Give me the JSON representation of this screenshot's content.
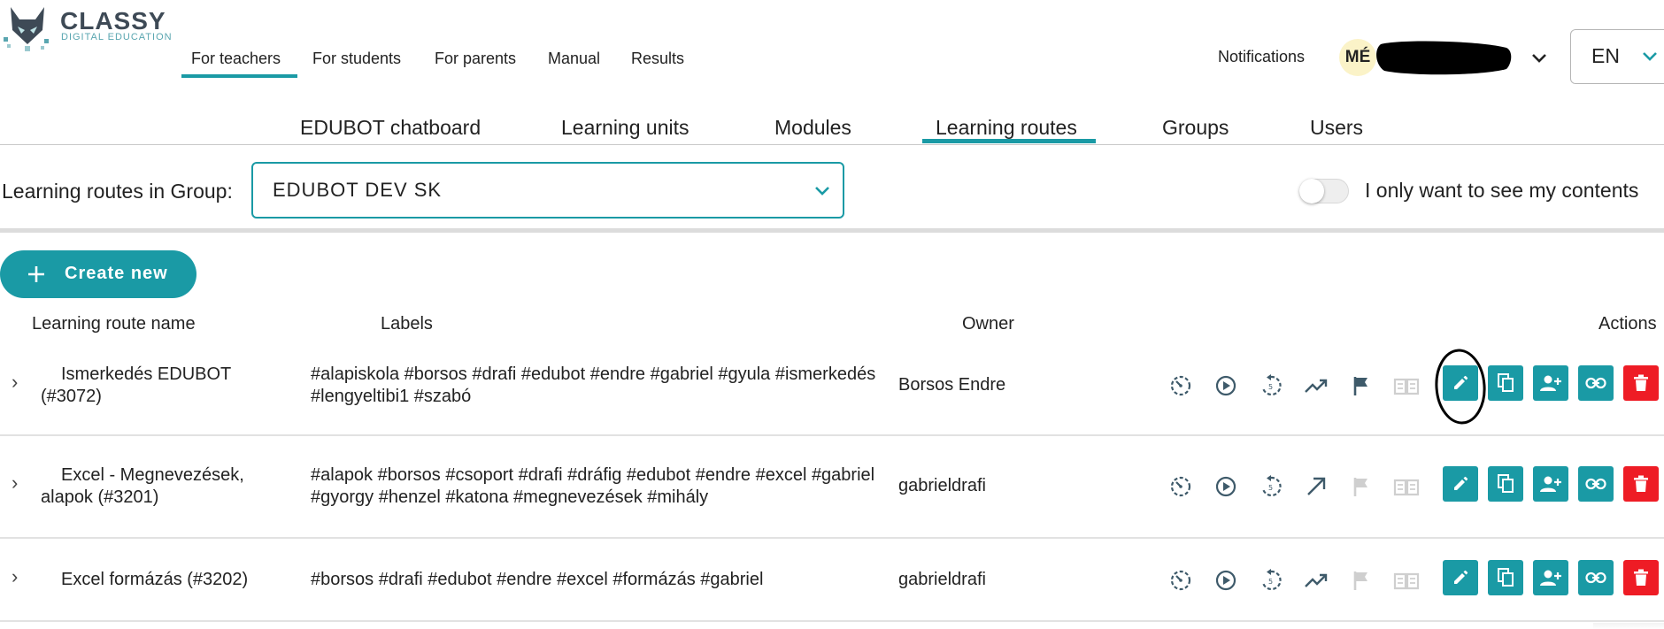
{
  "brand": {
    "title": "CLASSY",
    "subtitle": "DIGITAL EDUCATION"
  },
  "topnav": [
    "For teachers",
    "For students",
    "For parents",
    "Manual",
    "Results"
  ],
  "header": {
    "notifications": "Notifications",
    "avatar_initials": "MÉ",
    "language": "EN"
  },
  "subnav": [
    "EDUBOT chatboard",
    "Learning units",
    "Modules",
    "Learning routes",
    "Groups",
    "Users"
  ],
  "filter": {
    "group_label": "Learning routes in Group:",
    "group_value": "EDUBOT DEV SK",
    "toggle_label": "I only want to see my contents",
    "toggle_on": false
  },
  "create_label": "Create new",
  "columns": {
    "name": "Learning route name",
    "labels": "Labels",
    "owner": "Owner",
    "actions": "Actions"
  },
  "rows": [
    {
      "name": "Ismerkedés EDUBOT (#3072)",
      "labels": "#alapiskola #borsos #drafi #edubot #endre #gabriel #gyula #ismerkedés #lengyeltibi1 #szabó",
      "owner": "Borsos Endre",
      "trend": "trending-up",
      "flag_active": true
    },
    {
      "name": "Excel - Megnevezések, alapok (#3201)",
      "labels": "#alapok #borsos #csoport #drafi #dráfig #edubot #endre #excel #gabriel #gyorgy #henzel #katona #megnevezések #mihály",
      "owner": "gabrieldrafi",
      "trend": "arrow-up-right",
      "flag_active": false
    },
    {
      "name": "Excel formázás (#3202)",
      "labels": "#borsos #drafi #edubot #endre #excel #formázás #gabriel",
      "owner": "gabrieldrafi",
      "trend": "trending-up",
      "flag_active": false
    }
  ],
  "colors": {
    "accent": "#1a9aa5",
    "danger": "#ee1c25",
    "icon_gray": "#3e5a6a",
    "icon_faded": "#cfcfcf"
  }
}
